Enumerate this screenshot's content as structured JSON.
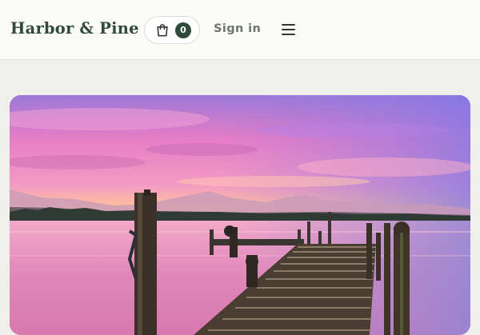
{
  "header": {
    "brand": "Harbor & Pine",
    "cart": {
      "count": "0",
      "icon": "shopping-bag-icon"
    },
    "sign_in_label": "Sign in",
    "menu_icon": "hamburger-menu-icon"
  },
  "hero": {
    "image_alt": "",
    "colors": {
      "sky_top": "#8f7fe0",
      "sky_mid": "#e77cc4",
      "horizon": "#ffc29a",
      "water": "#e58fb8",
      "dock": "#3a3026"
    }
  },
  "colors": {
    "brand": "#2f4a3c",
    "page_bg": "#efefec",
    "header_bg": "#fbfbf9"
  }
}
